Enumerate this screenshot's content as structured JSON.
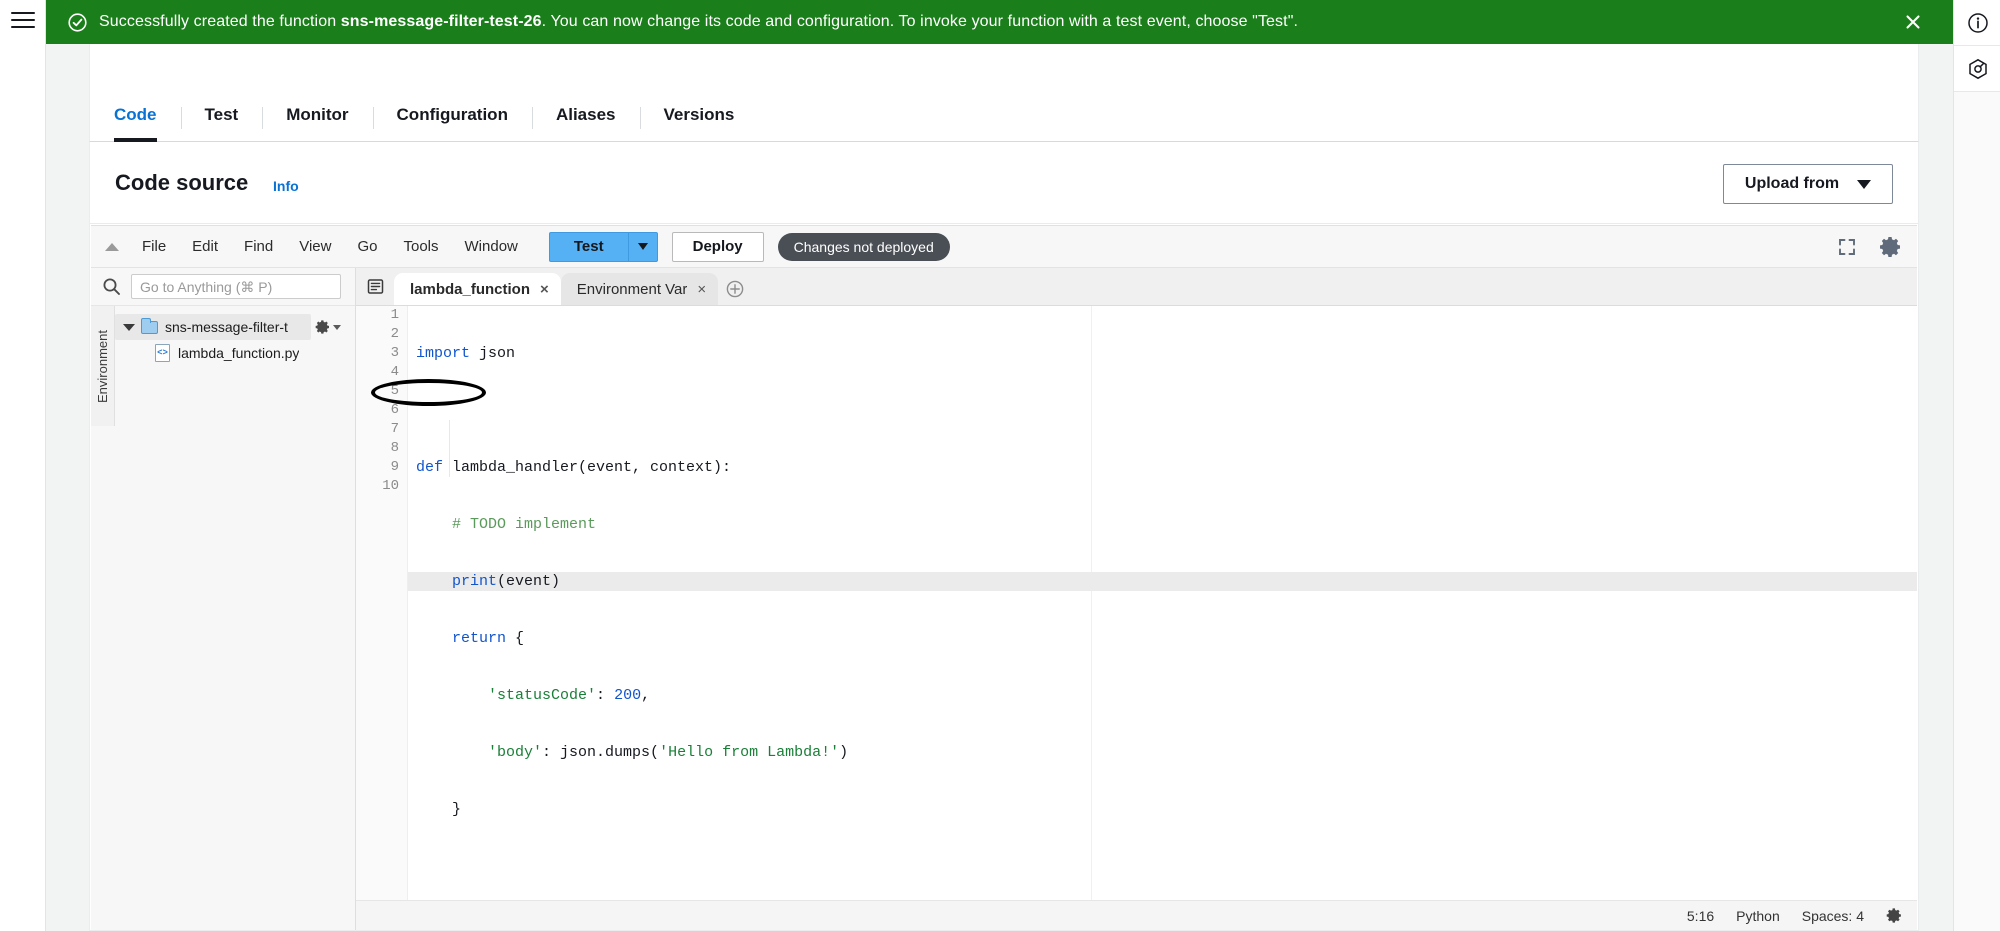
{
  "flashbar": {
    "icon": "check-circle-icon",
    "text_before": "Successfully created the function ",
    "function_name": "sns-message-filter-test-26",
    "text_after": ". You can now change its code and configuration. To invoke your function with a test event, choose \"Test\".",
    "close_label": "✕",
    "background": "#1a7e1a"
  },
  "right_rail": {
    "info_icon": "info-circle-icon",
    "settings_icon": "hexagon-settings-icon"
  },
  "tabs": [
    {
      "label": "Code",
      "active": true
    },
    {
      "label": "Test",
      "active": false
    },
    {
      "label": "Monitor",
      "active": false
    },
    {
      "label": "Configuration",
      "active": false
    },
    {
      "label": "Aliases",
      "active": false
    },
    {
      "label": "Versions",
      "active": false
    }
  ],
  "panel": {
    "title": "Code source",
    "info_link": "Info",
    "upload_button": "Upload from",
    "upload_caret": "chevron-down-icon"
  },
  "ide": {
    "menu_items": [
      "File",
      "Edit",
      "Find",
      "View",
      "Go",
      "Tools",
      "Window"
    ],
    "test_button": "Test",
    "deploy_button": "Deploy",
    "status_badge": "Changes not deployed",
    "expand_icon": "fullscreen-icon",
    "settings_icon": "gear-icon",
    "test_button_color": "#55b1f3",
    "badge_color": "#4a4f55"
  },
  "sidebar": {
    "search_placeholder": "Go to Anything (⌘ P)",
    "search_value": "",
    "search_icon": "search-icon",
    "vertical_tab": "Environment",
    "tree": {
      "folder": "sns-message-filter-t",
      "folder_gear": "gear-icon",
      "file": "lambda_function.py"
    }
  },
  "editor": {
    "panel_toggle_icon": "toggle-panel-icon",
    "tabs": [
      {
        "label": "lambda_function",
        "active": true,
        "close": "×"
      },
      {
        "label": "Environment Var",
        "active": false,
        "close": "×"
      }
    ],
    "add_tab": "+",
    "line_numbers": [
      "1",
      "2",
      "3",
      "4",
      "5",
      "6",
      "7",
      "8",
      "9",
      "10"
    ],
    "code_lines": [
      {
        "n": 1,
        "highlight": false
      },
      {
        "n": 2,
        "highlight": false
      },
      {
        "n": 3,
        "highlight": false
      },
      {
        "n": 4,
        "highlight": false
      },
      {
        "n": 5,
        "highlight": true
      },
      {
        "n": 6,
        "highlight": false
      },
      {
        "n": 7,
        "highlight": false
      },
      {
        "n": 8,
        "highlight": false
      },
      {
        "n": 9,
        "highlight": false
      },
      {
        "n": 10,
        "highlight": false
      }
    ],
    "code_text": {
      "l1_kw": "import",
      "l1_rest": " json",
      "l3_kw": "def",
      "l3_rest": " lambda_handler(event, context):",
      "l4": "    # TODO implement",
      "l5_kw": "print",
      "l5_rest": "(event)",
      "l6_kw": "return",
      "l6_rest": " {",
      "l7_str": "'statusCode'",
      "l7_mid": ": ",
      "l7_num": "200",
      "l7_end": ",",
      "l8_str": "'body'",
      "l8_mid": ": json.dumps(",
      "l8_str2": "'Hello from Lambda!'",
      "l8_end": ")",
      "l9": "    }"
    },
    "annotation": "ellipse-highlight-print-event",
    "status": {
      "cursor": "5:16",
      "language": "Python",
      "indent": "Spaces: 4",
      "gear": "gear-icon"
    }
  }
}
